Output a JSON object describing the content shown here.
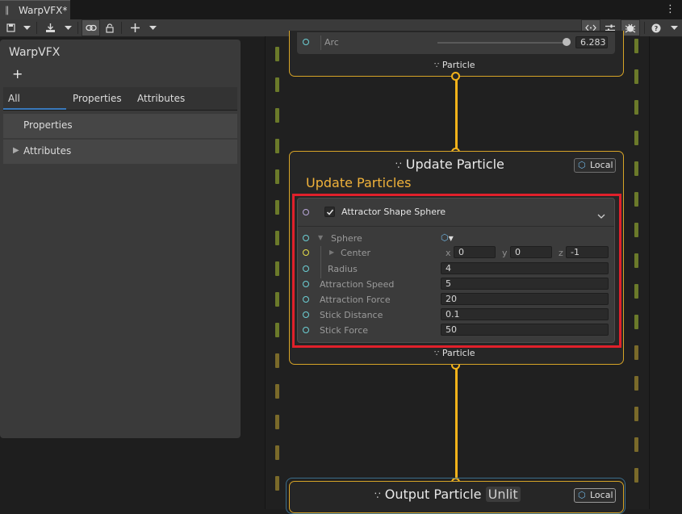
{
  "window": {
    "tab_title": "WarpVFX*"
  },
  "blackboard": {
    "title": "WarpVFX",
    "add_label": "+",
    "tabs": [
      "All",
      "Properties",
      "Attributes"
    ],
    "rows": [
      "Properties",
      "Attributes"
    ]
  },
  "graph": {
    "top_node": {
      "arc_label": "Arc",
      "arc_value": "6.283",
      "arc_slider_fraction": 0.97,
      "flow_label": "Particle"
    },
    "update_node": {
      "title": "Update Particle",
      "space_label": "Local",
      "subtitle": "Update Particles",
      "block": {
        "title": "Attractor Shape Sphere",
        "enabled": true,
        "sphere_label": "Sphere",
        "center_label": "Center",
        "center": {
          "x_label": "x",
          "x": "0",
          "y_label": "y",
          "y": "0",
          "z_label": "z",
          "z": "-1"
        },
        "radius_label": "Radius",
        "radius": "4",
        "attraction_speed_label": "Attraction Speed",
        "attraction_speed": "5",
        "attraction_force_label": "Attraction Force",
        "attraction_force": "20",
        "stick_distance_label": "Stick Distance",
        "stick_distance": "0.1",
        "stick_force_label": "Stick Force",
        "stick_force": "50"
      },
      "flow_label": "Particle"
    },
    "output_node": {
      "title": "Output Particle",
      "title_tag": "Unlit",
      "space_label": "Local"
    }
  },
  "colors": {
    "context_border": "#d7a427",
    "flow_wire": "#f3b21a",
    "highlight": "#e0202b",
    "subtitle": "#f0b23a"
  }
}
